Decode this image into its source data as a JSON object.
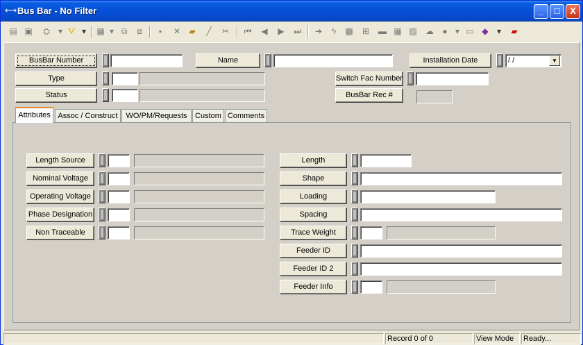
{
  "window": {
    "title": "Bus Bar - No Filter",
    "controls": [
      "_",
      "□",
      "X"
    ]
  },
  "header": {
    "busbar_number_label": "BusBar Number",
    "name_label": "Name",
    "installation_date_label": "Installation Date",
    "installation_date_value": " /  /",
    "type_label": "Type",
    "status_label": "Status",
    "switch_fac_number_label": "Switch Fac Number",
    "busbar_rec_label": "BusBar Rec #"
  },
  "tabs": [
    "Attributes",
    "Assoc / Construct",
    "WO/PM/Requests",
    "Custom",
    "Comments"
  ],
  "attributes_left": [
    "Length Source",
    "Nominal Voltage",
    "Operating Voltage",
    "Phase Designation",
    "Non Traceable"
  ],
  "attributes_right": [
    "Length",
    "Shape",
    "Loading",
    "Spacing",
    "Trace Weight",
    "Feeder ID",
    "Feeder ID 2",
    "Feeder Info"
  ],
  "status": {
    "record": "Record 0 of 0",
    "mode": "View Mode",
    "state": "Ready..."
  }
}
